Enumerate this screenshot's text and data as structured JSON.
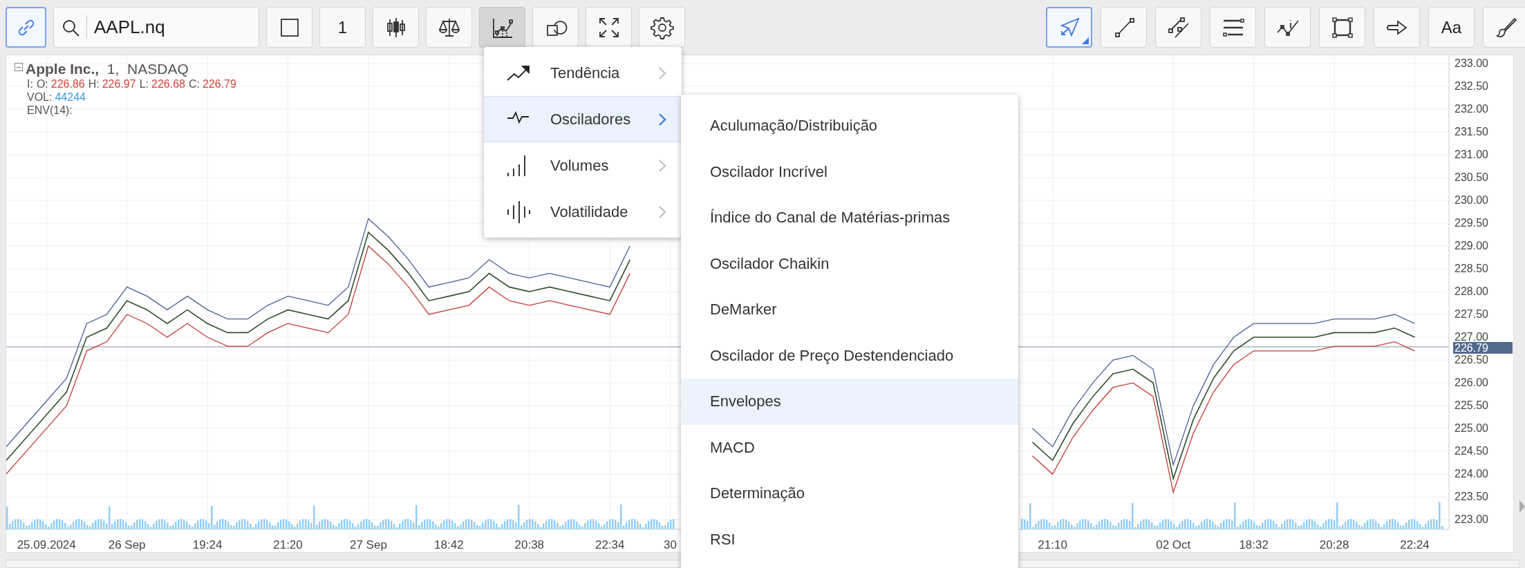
{
  "link_button": {
    "selected": true
  },
  "search": {
    "value": "AAPL.nq"
  },
  "tools_left": [
    {
      "kind": "square",
      "selected": false
    },
    {
      "kind": "interval",
      "text": "1",
      "selected": false
    },
    {
      "kind": "candles",
      "selected": false
    },
    {
      "kind": "scales",
      "selected": false
    },
    {
      "kind": "indicators",
      "selected": true
    },
    {
      "kind": "shapes",
      "selected": false
    },
    {
      "kind": "fullscreen",
      "selected": false
    },
    {
      "kind": "settings",
      "selected": false
    }
  ],
  "tools_right": [
    {
      "kind": "cursor",
      "selected": true
    },
    {
      "kind": "line",
      "selected": false
    },
    {
      "kind": "parallel",
      "selected": false
    },
    {
      "kind": "levels",
      "selected": false
    },
    {
      "kind": "wave",
      "selected": false
    },
    {
      "kind": "rectangle",
      "selected": false
    },
    {
      "kind": "arrow",
      "selected": false
    },
    {
      "kind": "text",
      "text": "Aa",
      "selected": false
    },
    {
      "kind": "brush",
      "selected": false
    }
  ],
  "legend": {
    "title": "**Apple Inc.,**  1,  NASDAQ",
    "prefix": "I:",
    "fields": [
      {
        "label": "O:",
        "value": "226.86"
      },
      {
        "label": "H:",
        "value": "226.97"
      },
      {
        "label": "L:",
        "value": "226.68"
      },
      {
        "label": "C:",
        "value": "226.79"
      }
    ],
    "volume": {
      "label": "VOL:",
      "value": "44244"
    },
    "indicator": "ENV(14):"
  },
  "chart": {
    "chart_data": {
      "type": "line",
      "grid": true,
      "ylim": [
        222.79,
        233.18
      ],
      "categories": [
        null,
        null,
        "25.09.2024",
        null,
        null,
        null,
        "26 Sep",
        null,
        null,
        null,
        "19:24",
        null,
        null,
        null,
        "21:20",
        null,
        null,
        null,
        "27 Sep",
        null,
        null,
        null,
        "18:42",
        null,
        null,
        null,
        "20:38",
        null,
        null,
        null,
        "22:34",
        null,
        null,
        "30",
        null,
        null,
        null,
        null,
        null,
        null,
        null,
        null,
        null,
        null,
        null,
        null,
        null,
        null,
        null,
        null,
        null,
        null,
        "21:10",
        null,
        null,
        null,
        null,
        null,
        "02 Oct",
        null,
        null,
        null,
        "18:32",
        null,
        null,
        null,
        "20:28",
        null,
        null,
        null,
        "22:24",
        null
      ],
      "series": [
        {
          "color": "#2f4f2a",
          "values": [
            224.3,
            224.8,
            225.3,
            225.8,
            227.0,
            227.2,
            227.8,
            227.6,
            227.3,
            227.6,
            227.3,
            227.1,
            227.1,
            227.4,
            227.6,
            227.5,
            227.4,
            227.8,
            229.3,
            228.9,
            228.4,
            227.8,
            227.9,
            228.0,
            228.4,
            228.1,
            228.0,
            228.1,
            228.0,
            227.9,
            227.8,
            228.7,
            null,
            null,
            null,
            null,
            null,
            null,
            null,
            null,
            null,
            null,
            null,
            null,
            null,
            null,
            null,
            null,
            null,
            null,
            null,
            224.7,
            224.3,
            225.1,
            225.7,
            226.2,
            226.3,
            226.0,
            223.9,
            225.2,
            226.1,
            226.7,
            227.0,
            227.0,
            227.0,
            227.0,
            227.1,
            227.1,
            227.1,
            227.2,
            227.0,
            null
          ]
        },
        {
          "color": "#4a5f96",
          "values": [
            224.6,
            225.1,
            225.6,
            226.1,
            227.3,
            227.5,
            228.1,
            227.9,
            227.6,
            227.9,
            227.6,
            227.4,
            227.4,
            227.7,
            227.9,
            227.8,
            227.7,
            228.1,
            229.6,
            229.2,
            228.7,
            228.1,
            228.2,
            228.3,
            228.7,
            228.4,
            228.3,
            228.4,
            228.3,
            228.2,
            228.1,
            229.0,
            null,
            null,
            null,
            null,
            null,
            null,
            null,
            null,
            null,
            null,
            null,
            null,
            null,
            null,
            null,
            null,
            null,
            null,
            null,
            225.0,
            224.6,
            225.4,
            226.0,
            226.5,
            226.6,
            226.3,
            224.2,
            225.5,
            226.4,
            227.0,
            227.3,
            227.3,
            227.3,
            227.3,
            227.4,
            227.4,
            227.4,
            227.5,
            227.3,
            null
          ]
        },
        {
          "color": "#c43a34",
          "values": [
            224.0,
            224.5,
            225.0,
            225.5,
            226.7,
            226.9,
            227.5,
            227.3,
            227.0,
            227.3,
            227.0,
            226.8,
            226.8,
            227.1,
            227.3,
            227.2,
            227.1,
            227.5,
            229.0,
            228.6,
            228.1,
            227.5,
            227.6,
            227.7,
            228.1,
            227.8,
            227.7,
            227.8,
            227.7,
            227.6,
            227.5,
            228.4,
            null,
            null,
            null,
            null,
            null,
            null,
            null,
            null,
            null,
            null,
            null,
            null,
            null,
            null,
            null,
            null,
            null,
            null,
            null,
            224.4,
            224.0,
            224.8,
            225.4,
            225.9,
            226.0,
            225.7,
            223.6,
            224.9,
            225.8,
            226.4,
            226.7,
            226.7,
            226.7,
            226.7,
            226.8,
            226.8,
            226.8,
            226.9,
            226.7,
            null
          ]
        }
      ],
      "yticks": [
        {
          "value": 233,
          "label": "233.00"
        },
        {
          "value": 232.5,
          "label": "232.50"
        },
        {
          "value": 232,
          "label": "232.00"
        },
        {
          "value": 231.5,
          "label": "231.50"
        },
        {
          "value": 231,
          "label": "231.00"
        },
        {
          "value": 230.5,
          "label": "230.50"
        },
        {
          "value": 230,
          "label": "230.00"
        },
        {
          "value": 229.5,
          "label": "229.50"
        },
        {
          "value": 229,
          "label": "229.00"
        },
        {
          "value": 228.5,
          "label": "228.50"
        },
        {
          "value": 228,
          "label": "228.00"
        },
        {
          "value": 227.5,
          "label": "227.50"
        },
        {
          "value": 227,
          "label": "227.00"
        },
        {
          "value": 226.5,
          "label": "226.50"
        },
        {
          "value": 226,
          "label": "226.00"
        },
        {
          "value": 225.5,
          "label": "225.50"
        },
        {
          "value": 225,
          "label": "225.00"
        },
        {
          "value": 224.5,
          "label": "224.50"
        },
        {
          "value": 224,
          "label": "224.00"
        },
        {
          "value": 223.5,
          "label": "223.50"
        },
        {
          "value": 223,
          "label": "223.00"
        }
      ],
      "ref_lines": [
        {
          "axis": "y",
          "value": 226.79,
          "label": "226.79"
        }
      ]
    }
  },
  "indicator_menu": {
    "items": [
      {
        "kind": "trend",
        "label": "Tendência",
        "selected": false
      },
      {
        "kind": "oscillator",
        "label": "Osciladores",
        "selected": true
      },
      {
        "kind": "volume",
        "label": "Volumes",
        "selected": false
      },
      {
        "kind": "volatility",
        "label": "Volatilidade",
        "selected": false
      }
    ]
  },
  "submenu": {
    "items": [
      {
        "label": "Aculumação/Distribuição",
        "selected": false
      },
      {
        "label": "Oscilador Incrível",
        "selected": false
      },
      {
        "label": "Índice do Canal de Matérias-primas",
        "selected": false
      },
      {
        "label": "Oscilador Chaikin",
        "selected": false
      },
      {
        "label": "DeMarker",
        "selected": false
      },
      {
        "label": "Oscilador de Preço Destendenciado",
        "selected": false
      },
      {
        "label": "Envelopes",
        "selected": true
      },
      {
        "label": "MACD",
        "selected": false
      },
      {
        "label": "Determinação",
        "selected": false
      },
      {
        "label": "RSI",
        "selected": false
      }
    ]
  }
}
